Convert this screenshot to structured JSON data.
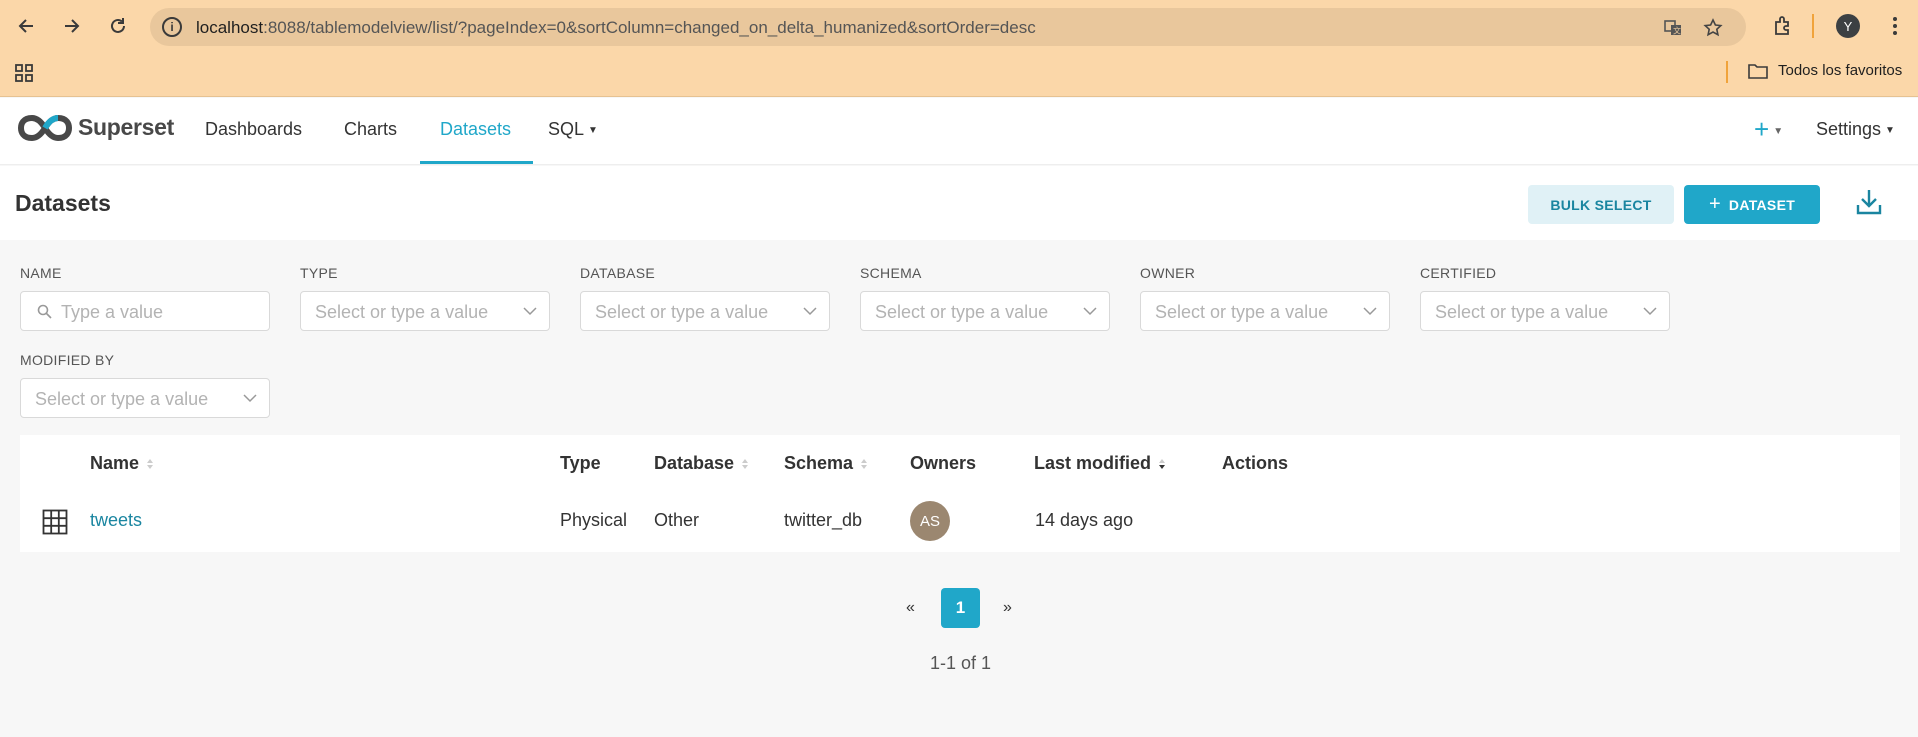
{
  "browser": {
    "url_host": "localhost",
    "url_rest": ":8088/tablemodelview/list/?pageIndex=0&sortColumn=changed_on_delta_humanized&sortOrder=desc",
    "profile_initial": "Y",
    "bookmarks_folder": "Todos los favoritos",
    "icons": [
      "back-icon",
      "forward-icon",
      "reload-icon",
      "site-info-icon",
      "translate-icon",
      "star-icon",
      "extensions-icon",
      "menu-icon",
      "apps-icon",
      "folder-icon"
    ]
  },
  "header": {
    "brand": "Superset",
    "nav": [
      {
        "label": "Dashboards"
      },
      {
        "label": "Charts"
      },
      {
        "label": "Datasets"
      },
      {
        "label": "SQL"
      }
    ],
    "settings_label": "Settings",
    "plus_label": "+"
  },
  "page": {
    "title": "Datasets",
    "bulk_select_label": "BULK SELECT",
    "add_dataset_label": "DATASET",
    "add_dataset_prefix": "+"
  },
  "filters": {
    "name": {
      "label": "NAME",
      "placeholder": "Type a value"
    },
    "type": {
      "label": "TYPE",
      "placeholder": "Select or type a value"
    },
    "database": {
      "label": "DATABASE",
      "placeholder": "Select or type a value"
    },
    "schema": {
      "label": "SCHEMA",
      "placeholder": "Select or type a value"
    },
    "owner": {
      "label": "OWNER",
      "placeholder": "Select or type a value"
    },
    "certified": {
      "label": "CERTIFIED",
      "placeholder": "Select or type a value"
    },
    "modified_by": {
      "label": "MODIFIED BY",
      "placeholder": "Select or type a value"
    }
  },
  "table": {
    "columns": {
      "name": "Name",
      "type": "Type",
      "database": "Database",
      "schema": "Schema",
      "owners": "Owners",
      "last_modified": "Last modified",
      "actions": "Actions"
    },
    "rows": [
      {
        "name": "tweets",
        "type": "Physical",
        "database": "Other",
        "schema": "twitter_db",
        "owner_initials": "AS",
        "last_modified": "14 days ago"
      }
    ]
  },
  "pagination": {
    "prev": "«",
    "current": "1",
    "next": "»",
    "summary": "1-1 of 1"
  },
  "colors": {
    "accent": "#20a7c9",
    "browser_bg": "#fbd7a9",
    "owner_avatar": "#9b8770"
  }
}
